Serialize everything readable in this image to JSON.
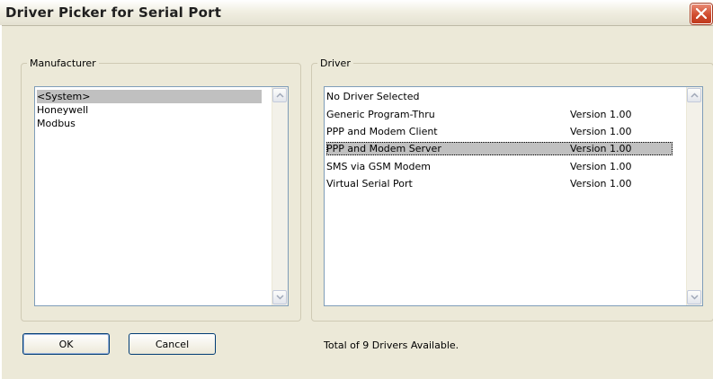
{
  "window": {
    "title": "Driver Picker for Serial Port",
    "close_icon": "close-icon",
    "close_color": "#d14c2f"
  },
  "manufacturer": {
    "legend": "Manufacturer",
    "items": [
      {
        "label": "<System>",
        "selected": true
      },
      {
        "label": "Honeywell",
        "selected": false
      },
      {
        "label": "Modbus",
        "selected": false
      }
    ]
  },
  "driver": {
    "legend": "Driver",
    "items": [
      {
        "name": "No Driver Selected",
        "version": "",
        "selected": false
      },
      {
        "name": "Generic Program-Thru",
        "version": "Version 1.00",
        "selected": false
      },
      {
        "name": "PPP and Modem Client",
        "version": "Version 1.00",
        "selected": false
      },
      {
        "name": "PPP and Modem Server",
        "version": "Version 1.00",
        "selected": true
      },
      {
        "name": "SMS via GSM Modem",
        "version": "Version 1.00",
        "selected": false
      },
      {
        "name": "Virtual Serial Port",
        "version": "Version 1.00",
        "selected": false
      }
    ]
  },
  "buttons": {
    "ok_label": "OK",
    "cancel_label": "Cancel"
  },
  "status": {
    "text": "Total of 9 Drivers Available."
  },
  "colors": {
    "dialog_bg": "#ece9d8",
    "selection_bg": "#c0c0c0",
    "list_border": "#7f9db9"
  }
}
